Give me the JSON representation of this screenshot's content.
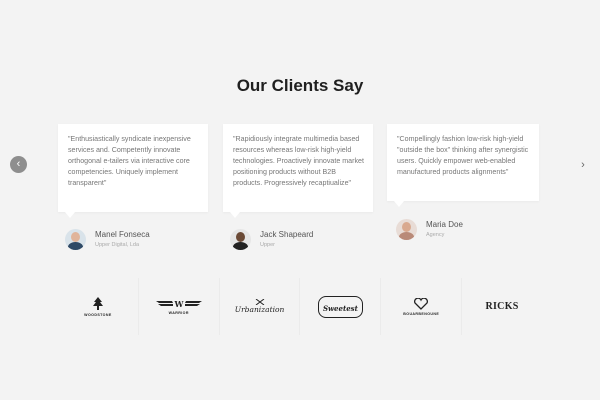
{
  "section_title": "Our Clients Say",
  "nav": {
    "prev_icon": "chevron-left-icon",
    "next_icon": "chevron-right-icon",
    "prev_glyph": "‹",
    "next_glyph": "›"
  },
  "testimonials": [
    {
      "quote": "\"Enthusiastically syndicate inexpensive services and. Competently innovate orthogonal e-tailers via interactive core competencies. Uniquely implement transparent\"",
      "name": "Manel Fonseca",
      "role": "Upper Digital, Lda"
    },
    {
      "quote": "\"Rapidiously integrate multimedia based resources whereas low-risk high-yield technologies. Proactively innovate market positioning products without B2B products. Progressively recaptiualize\"",
      "name": "Jack Shapeard",
      "role": "Upper"
    },
    {
      "quote": "\"Compellingly fashion low-risk high-yield \"outside the box\" thinking after synergistic users. Quickly empower web-enabled manufactured products alignments\"",
      "name": "Maria Doe",
      "role": "Agency"
    }
  ],
  "logos": [
    {
      "name": "woodstone",
      "text": "WOODSTONE"
    },
    {
      "name": "warrior",
      "text": "WARRIOR",
      "mark": "W"
    },
    {
      "name": "urbanization",
      "text": "Urbanization"
    },
    {
      "name": "sweetest",
      "text": "Sweetest"
    },
    {
      "name": "bouarbenoune",
      "text": "BOUARBENOUNE"
    },
    {
      "name": "ricks",
      "text": "RICKS"
    }
  ],
  "colors": {
    "background": "#f3f3f3",
    "card": "#ffffff",
    "nav_prev_bg": "#8e8e8e"
  }
}
